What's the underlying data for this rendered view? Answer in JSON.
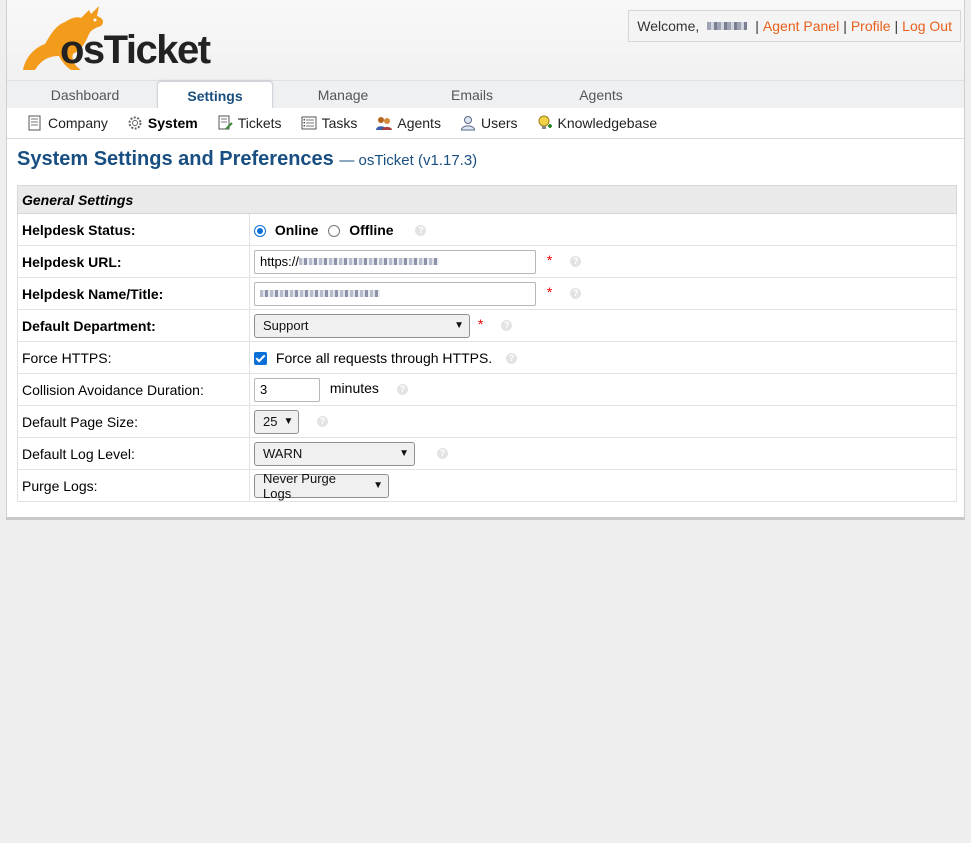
{
  "colors": {
    "accent": "#184e81",
    "link": "#e8601c",
    "brand_orange": "#f39c1c"
  },
  "logo": {
    "text": "osTicket",
    "icon": "kangaroo-icon"
  },
  "user_box": {
    "welcome": "Welcome,",
    "separator": "|",
    "agent_panel": "Agent Panel",
    "profile": "Profile",
    "logout": "Log Out"
  },
  "nav": {
    "tabs": [
      "Dashboard",
      "Settings",
      "Manage",
      "Emails",
      "Agents"
    ],
    "active": "Settings"
  },
  "subnav": {
    "items": [
      {
        "label": "Company",
        "icon": "company-icon"
      },
      {
        "label": "System",
        "icon": "gear-icon",
        "active": true
      },
      {
        "label": "Tickets",
        "icon": "ticket-edit-icon"
      },
      {
        "label": "Tasks",
        "icon": "tasks-icon"
      },
      {
        "label": "Agents",
        "icon": "agents-icon"
      },
      {
        "label": "Users",
        "icon": "user-icon"
      },
      {
        "label": "Knowledgebase",
        "icon": "knowledgebase-icon"
      }
    ]
  },
  "page": {
    "title": "System Settings and Preferences",
    "version": "— osTicket (v1.17.3)"
  },
  "settings": {
    "section_title": "General Settings",
    "helpdesk_status": {
      "label": "Helpdesk Status:",
      "online": "Online",
      "offline": "Offline",
      "selected": "Online"
    },
    "helpdesk_url": {
      "label": "Helpdesk URL:",
      "value_prefix": "https://"
    },
    "helpdesk_name": {
      "label": "Helpdesk Name/Title:"
    },
    "default_department": {
      "label": "Default Department:",
      "value": "Support"
    },
    "force_https": {
      "label": "Force HTTPS:",
      "checkbox_label": "Force all requests through HTTPS.",
      "checked": true
    },
    "collision": {
      "label": "Collision Avoidance Duration:",
      "value": "3",
      "unit": "minutes"
    },
    "page_size": {
      "label": "Default Page Size:",
      "value": "25"
    },
    "log_level": {
      "label": "Default Log Level:",
      "value": "WARN"
    },
    "purge_logs": {
      "label": "Purge Logs:",
      "value": "Never Purge Logs"
    },
    "required_mark": "*",
    "help_glyph": "?"
  }
}
